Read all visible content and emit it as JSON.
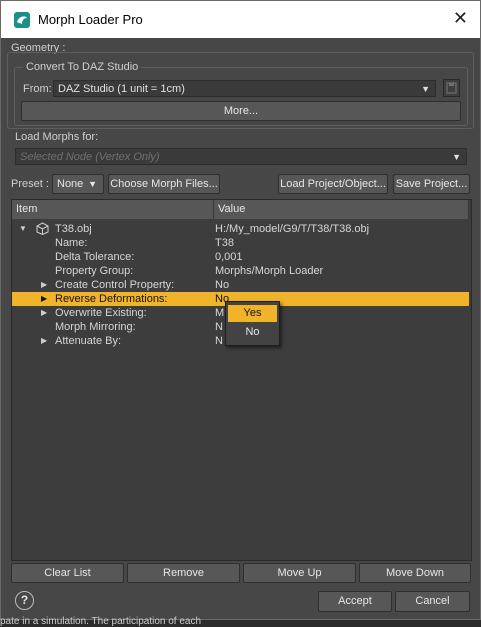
{
  "window": {
    "title": "Morph Loader Pro",
    "close_glyph": "✕"
  },
  "geometry": {
    "label": "Geometry :",
    "convert_label": "Convert To DAZ Studio",
    "from_label": "From:",
    "from_value": "DAZ Studio (1 unit = 1cm)",
    "more_button": "More..."
  },
  "load_morphs": {
    "label": "Load Morphs for:",
    "value": "Selected Node (Vertex Only)"
  },
  "preset": {
    "label": "Preset :",
    "value": "None",
    "choose_button": "Choose Morph Files...",
    "load_project_button": "Load Project/Object...",
    "save_project_button": "Save Project..."
  },
  "tree": {
    "col_item": "Item",
    "col_value": "Value",
    "root": {
      "name": "T38.obj",
      "value": "H:/My_model/G9/T/T38/T38.obj"
    },
    "rows": [
      {
        "key": "Name:",
        "value": "T38"
      },
      {
        "key": "Delta Tolerance:",
        "value": "0,001"
      },
      {
        "key": "Property Group:",
        "value": "Morphs/Morph Loader"
      },
      {
        "key": "Create Control Property:",
        "value": "No"
      },
      {
        "key": "Reverse Deformations:",
        "value": "No"
      },
      {
        "key": "Overwrite Existing:",
        "value": "M"
      },
      {
        "key": "Morph Mirroring:",
        "value": "N"
      },
      {
        "key": "Attenuate By:",
        "value": "N"
      }
    ]
  },
  "popup": {
    "options": [
      "Yes",
      "No"
    ]
  },
  "bottom_buttons": {
    "clear": "Clear List",
    "remove": "Remove",
    "up": "Move Up",
    "down": "Move Down"
  },
  "footer": {
    "help": "?",
    "accept": "Accept",
    "cancel": "Cancel"
  },
  "background_text": "pate in a simulation. The participation of each",
  "colors": {
    "accent": "#f0b32a",
    "brand_icon": "#1e8f86",
    "dialog_bg": "#474747"
  }
}
